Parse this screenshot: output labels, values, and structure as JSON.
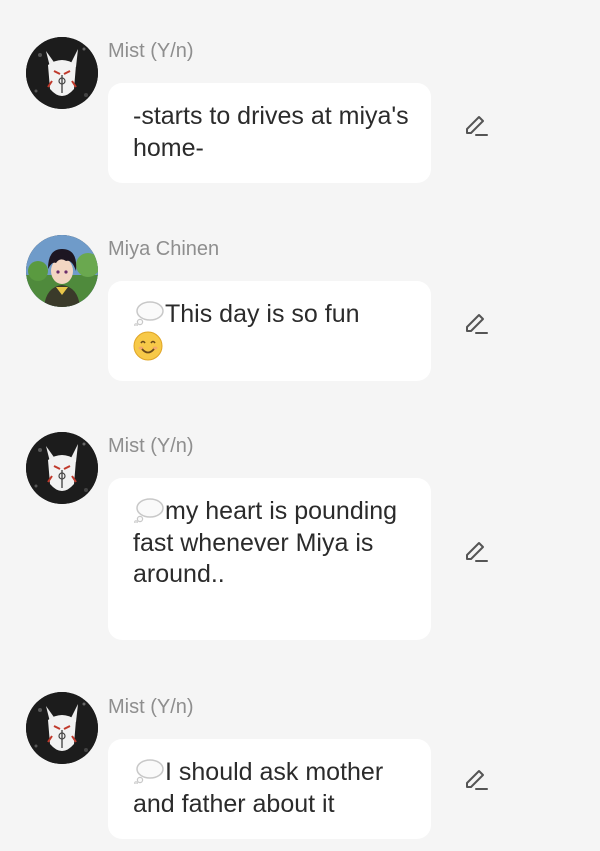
{
  "messages": [
    {
      "sender": "Mist (Y/n)",
      "avatar": "fox-mask-avatar",
      "thought": false,
      "text": "-starts to drives at miya's home-"
    },
    {
      "sender": "Miya Chinen",
      "avatar": "boy-portrait-avatar",
      "thought": true,
      "text": "This day is so fun",
      "emoji": "smiling-face-emoji"
    },
    {
      "sender": "Mist (Y/n)",
      "avatar": "fox-mask-avatar",
      "thought": true,
      "text": "my heart is pounding fast whenever Miya is around.."
    },
    {
      "sender": "Mist (Y/n)",
      "avatar": "fox-mask-avatar",
      "thought": true,
      "text": "I should ask mother and father about it"
    }
  ],
  "icons": {
    "edit": "pencil-edit-icon",
    "thought": "thought-bubble-icon"
  },
  "colors": {
    "background": "#f5f5f5",
    "bubble": "#ffffff",
    "sender_text": "#8e8e8e",
    "message_text": "#2b2b2b",
    "emoji": "#f7c948"
  }
}
